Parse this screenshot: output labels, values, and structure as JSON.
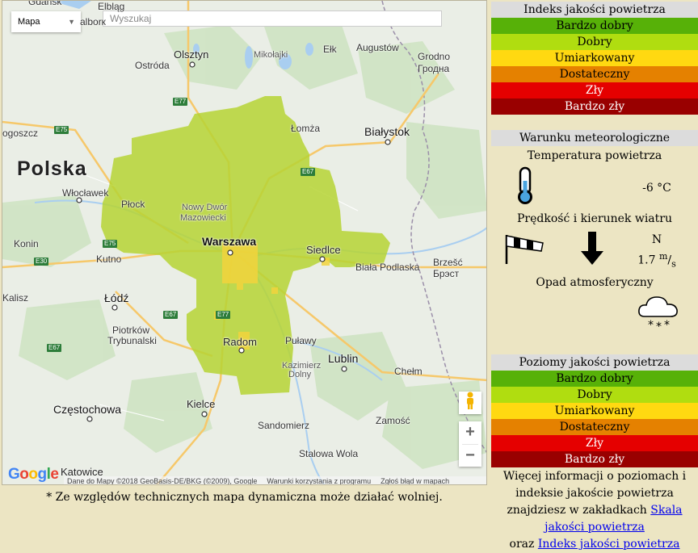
{
  "map": {
    "maptype_label": "Mapa",
    "search_placeholder": "Wyszukaj",
    "labels": {
      "gdansk": "Gdańsk",
      "elblag": "Elbląg",
      "malbork": "alborк",
      "ostroda": "Ostróda",
      "olsztyn": "Olsztyn",
      "mikolajki": "Mikołajki",
      "elk": "Ełk",
      "augustow": "Augustów",
      "grodno1": "Grodno",
      "grodno2": "Гродна",
      "gorzow": "ogoszcz",
      "lomza": "Łomża",
      "bialystok": "Białystok",
      "polska": "Polska",
      "wloclawek": "Włocławek",
      "plock": "Płock",
      "nowydwor1": "Nowy Dwór",
      "nowydwor2": "Mazowiecki",
      "warszawa": "Warszawa",
      "siedlce": "Siedlce",
      "konin": "Konin",
      "kutno": "Kutno",
      "biala": "Biała Podlaska",
      "brzesc1": "Brzešć",
      "brzesc2": "Брэст",
      "kalisz": "Kalisz",
      "lodz": "Łódź",
      "piotrkow1": "Piotrków",
      "piotrkow2": "Trybunalski",
      "radom": "Radom",
      "pulawy": "Puławy",
      "kazimierz1": "Kazimierz",
      "kazimierz2": "Dolny",
      "lublin": "Lublin",
      "chelm": "Chełm",
      "kielce": "Kielce",
      "czestochowa": "Częstochowa",
      "zamosc": "Zamość",
      "sandomierz": "Sandomierz",
      "stalowa": "Stalowa Wola",
      "katowice": "Katowice"
    },
    "roads": {
      "e77a": "E77",
      "e75a": "E75",
      "e67a": "E67",
      "e75b": "E75",
      "e30": "E30",
      "e67b": "E67",
      "e77b": "E77",
      "e67c": "E67"
    },
    "google_logo": "Google",
    "attribution": {
      "data": "Dane do Mapy ©2018 GeoBasis-DE/BKG (©2009), Google",
      "terms": "Warunki korzystania z programu",
      "report": "Zgłoś błąd w mapach"
    },
    "zoom_in": "+",
    "zoom_out": "−",
    "pegman_icon": "pegman-icon",
    "colors": {
      "area": "#b6d334",
      "area_hot": "#f2d33c",
      "water": "#a9cef0",
      "land": "#eaeee6",
      "forest": "#cfe3c3"
    }
  },
  "footnote": "* Ze względów technicznych mapa dynamiczna może działać wolniej.",
  "index_panel": {
    "title": "Indeks jakości powietrza",
    "levels": [
      {
        "label": "Bardzo dobry",
        "color": "#57b108"
      },
      {
        "label": "Dobry",
        "color": "#b0dd10"
      },
      {
        "label": "Umiarkowany",
        "color": "#ffd911"
      },
      {
        "label": "Dostateczny",
        "color": "#e58100"
      },
      {
        "label": "Zły",
        "color": "#e50000"
      },
      {
        "label": "Bardzo zły",
        "color": "#990000"
      }
    ]
  },
  "meteo": {
    "title": "Warunku meteorologiczne",
    "temp_title": "Temperatura powietrza",
    "temp_value": "-6 °C",
    "wind_title": "Prędkość i kierunek wiatru",
    "wind_dir": "N",
    "wind_speed": "1.7",
    "wind_unit_num": "m",
    "wind_unit_den": "s",
    "precip_title": "Opad atmosferyczny",
    "icons": {
      "thermometer": "thermometer-icon",
      "windsock": "windsock-icon",
      "arrow": "wind-arrow-icon",
      "snow": "snow-cloud-icon"
    }
  },
  "levels_panel": {
    "title": "Poziomy jakości powietrza",
    "levels": [
      {
        "label": "Bardzo dobry",
        "color": "#57b108"
      },
      {
        "label": "Dobry",
        "color": "#b0dd10"
      },
      {
        "label": "Umiarkowany",
        "color": "#ffd911"
      },
      {
        "label": "Dostateczny",
        "color": "#e58100"
      },
      {
        "label": "Zły",
        "color": "#e50000"
      },
      {
        "label": "Bardzo zły",
        "color": "#990000"
      }
    ]
  },
  "more_info": {
    "text1": "Więcej informacji o poziomach i indeksie jakoście powietrza znajdziesz w zakładkach",
    "link1": "Skala jakości powietrza",
    "text2": "oraz",
    "link2": "Indeks jakości powietrza"
  }
}
